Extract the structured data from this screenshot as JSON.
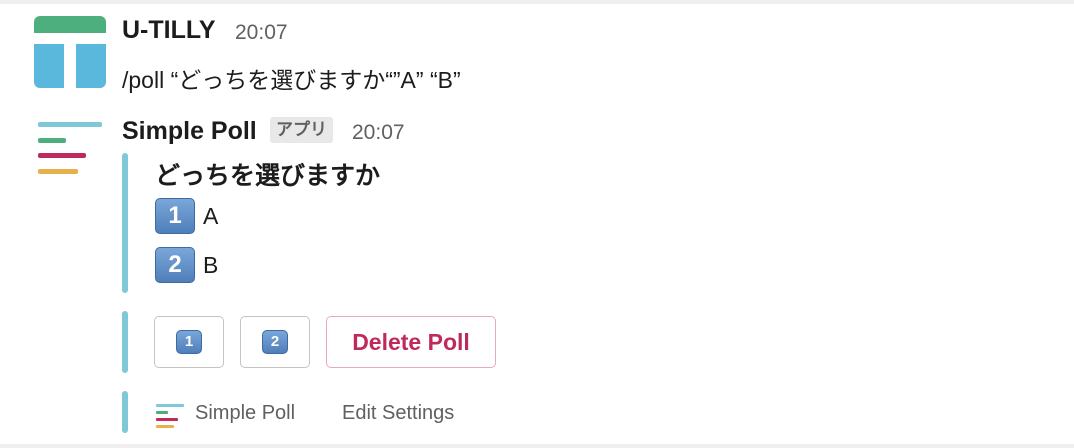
{
  "user_message": {
    "author": "U-TILLY",
    "time": "20:07",
    "text": "/poll “どっちを選びますか“”A” “B”"
  },
  "bot_message": {
    "author": "Simple Poll",
    "badge": "アプリ",
    "time": "20:07",
    "question": "どっちを選びますか",
    "options": [
      {
        "keycap": "1",
        "label": "A"
      },
      {
        "keycap": "2",
        "label": "B"
      }
    ],
    "buttons": {
      "vote1": "1",
      "vote2": "2",
      "delete": "Delete Poll"
    },
    "footer": {
      "app_name": "Simple Poll",
      "edit_settings": "Edit Settings"
    }
  },
  "colors": {
    "accent_bar": "#7ec8d8",
    "delete_text": "#c02a5b",
    "poll_icon_lines": [
      "#7ec8d8",
      "#4caf7d",
      "#c02a5b",
      "#e8b04a"
    ]
  }
}
